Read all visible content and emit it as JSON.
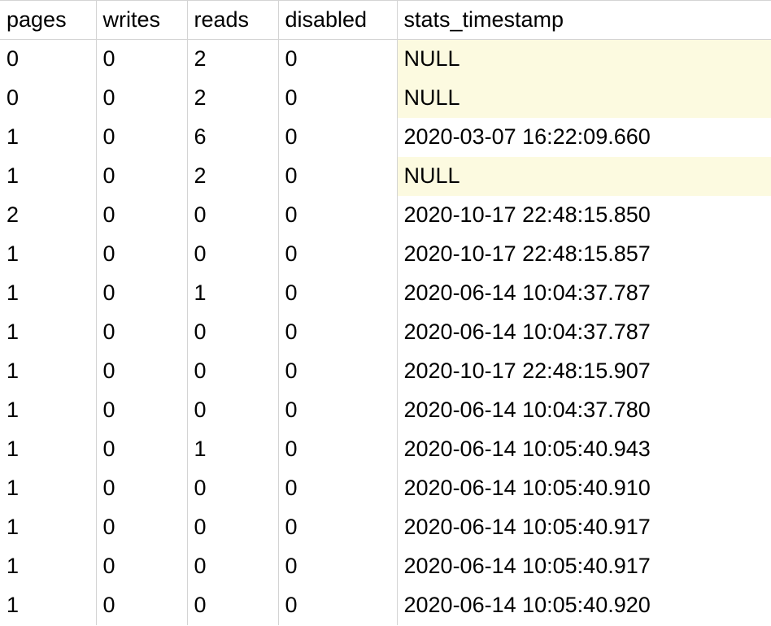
{
  "table": {
    "headers": {
      "pages": "pages",
      "writes": "writes",
      "reads": "reads",
      "disabled": "disabled",
      "stats_timestamp": "stats_timestamp"
    },
    "rows": [
      {
        "pages": "0",
        "writes": "0",
        "reads": "2",
        "disabled": "0",
        "stats_timestamp": "NULL",
        "ts_null": true
      },
      {
        "pages": "0",
        "writes": "0",
        "reads": "2",
        "disabled": "0",
        "stats_timestamp": "NULL",
        "ts_null": true
      },
      {
        "pages": "1",
        "writes": "0",
        "reads": "6",
        "disabled": "0",
        "stats_timestamp": "2020-03-07 16:22:09.660",
        "ts_null": false
      },
      {
        "pages": "1",
        "writes": "0",
        "reads": "2",
        "disabled": "0",
        "stats_timestamp": "NULL",
        "ts_null": true
      },
      {
        "pages": "2",
        "writes": "0",
        "reads": "0",
        "disabled": "0",
        "stats_timestamp": "2020-10-17 22:48:15.850",
        "ts_null": false
      },
      {
        "pages": "1",
        "writes": "0",
        "reads": "0",
        "disabled": "0",
        "stats_timestamp": "2020-10-17 22:48:15.857",
        "ts_null": false
      },
      {
        "pages": "1",
        "writes": "0",
        "reads": "1",
        "disabled": "0",
        "stats_timestamp": "2020-06-14 10:04:37.787",
        "ts_null": false
      },
      {
        "pages": "1",
        "writes": "0",
        "reads": "0",
        "disabled": "0",
        "stats_timestamp": "2020-06-14 10:04:37.787",
        "ts_null": false
      },
      {
        "pages": "1",
        "writes": "0",
        "reads": "0",
        "disabled": "0",
        "stats_timestamp": "2020-10-17 22:48:15.907",
        "ts_null": false
      },
      {
        "pages": "1",
        "writes": "0",
        "reads": "0",
        "disabled": "0",
        "stats_timestamp": "2020-06-14 10:04:37.780",
        "ts_null": false
      },
      {
        "pages": "1",
        "writes": "0",
        "reads": "1",
        "disabled": "0",
        "stats_timestamp": "2020-06-14 10:05:40.943",
        "ts_null": false
      },
      {
        "pages": "1",
        "writes": "0",
        "reads": "0",
        "disabled": "0",
        "stats_timestamp": "2020-06-14 10:05:40.910",
        "ts_null": false
      },
      {
        "pages": "1",
        "writes": "0",
        "reads": "0",
        "disabled": "0",
        "stats_timestamp": "2020-06-14 10:05:40.917",
        "ts_null": false
      },
      {
        "pages": "1",
        "writes": "0",
        "reads": "0",
        "disabled": "0",
        "stats_timestamp": "2020-06-14 10:05:40.917",
        "ts_null": false
      },
      {
        "pages": "1",
        "writes": "0",
        "reads": "0",
        "disabled": "0",
        "stats_timestamp": "2020-06-14 10:05:40.920",
        "ts_null": false
      }
    ]
  }
}
